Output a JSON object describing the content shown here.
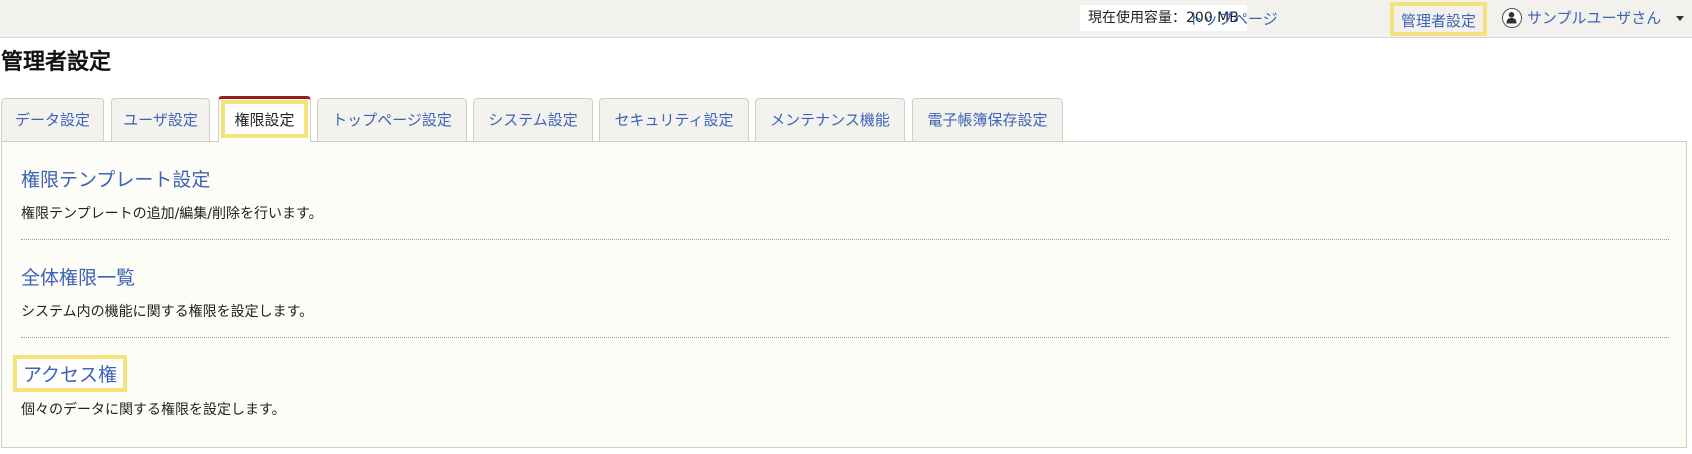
{
  "header": {
    "usage_text": "現在使用容量：200 MB",
    "links": {
      "top_page": "トップページ",
      "admin_settings": "管理者設定"
    },
    "user_name": "サンプルユーザさん"
  },
  "page_title": "管理者設定",
  "tabs": [
    {
      "label": "データ設定"
    },
    {
      "label": "ユーザ設定"
    },
    {
      "label": "権限設定",
      "active": true
    },
    {
      "label": "トップページ設定"
    },
    {
      "label": "システム設定"
    },
    {
      "label": "セキュリティ設定"
    },
    {
      "label": "メンテナンス機能"
    },
    {
      "label": "電子帳簿保存設定"
    }
  ],
  "sections": [
    {
      "title": "権限テンプレート設定",
      "description": "権限テンプレートの追加/編集/削除を行います。"
    },
    {
      "title": "全体権限一覧",
      "description": "システム内の機能に関する権限を設定します。"
    },
    {
      "title": "アクセス権",
      "description": "個々のデータに関する権限を設定します。"
    }
  ],
  "colors": {
    "link": "#3c63b5",
    "highlight": "#f3e37a",
    "active_tab_accent": "#9c1d1d",
    "panel_bg": "#fdfcf7"
  }
}
